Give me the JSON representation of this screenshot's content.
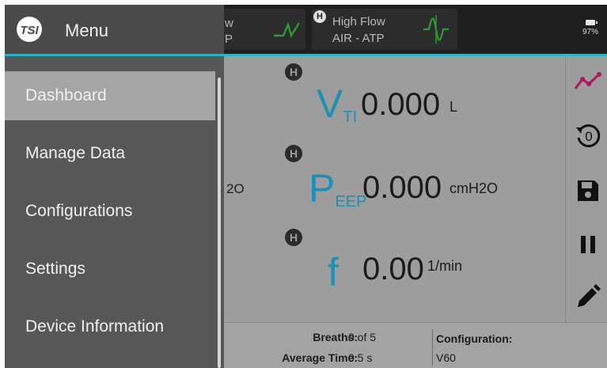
{
  "topbar": {
    "cards": [
      {
        "line1": "w",
        "line2": "P",
        "waveform": "rise-fall-waveform"
      },
      {
        "line1": "High Flow",
        "line2": "AIR - ATP",
        "badge": "H",
        "waveform": "sine-waveform"
      }
    ],
    "battery": {
      "percent": "97%",
      "icon": "battery-icon"
    }
  },
  "menu": {
    "title": "Menu",
    "logo": "TSI",
    "items": [
      {
        "label": "Dashboard",
        "active": true
      },
      {
        "label": "Manage Data",
        "active": false
      },
      {
        "label": "Configurations",
        "active": false
      },
      {
        "label": "Settings",
        "active": false
      },
      {
        "label": "Device Information",
        "active": false
      }
    ]
  },
  "readings": [
    {
      "badge": "H",
      "symbol": "V",
      "subscript": "TI",
      "value": "0.000",
      "unit": "L"
    },
    {
      "badge": "H",
      "symbol": "P",
      "subscript": "EEP",
      "value": "0.000",
      "unit": "cmH2O"
    },
    {
      "badge": "H",
      "symbol": "f",
      "subscript": "",
      "value": "0.00",
      "unit": "1/min"
    }
  ],
  "clipped_left_text": "2O",
  "toolbar": {
    "icons": [
      "trend-chart-icon",
      "zero-reset-icon",
      "save-icon",
      "pause-icon",
      "edit-pencil-icon"
    ],
    "colors": {
      "trend": "#b0175e",
      "default": "#111111"
    }
  },
  "status": {
    "breaths_label": "Breaths:",
    "breaths_value": "0 of 5",
    "avg_time_label": "Average Time:",
    "avg_time_value": "0.5 s",
    "config_label": "Configuration:",
    "config_value": "V60"
  },
  "colors": {
    "accent": "#2bb3c9",
    "symbol": "#1e8fb5",
    "waveform": "#2f9a32"
  }
}
